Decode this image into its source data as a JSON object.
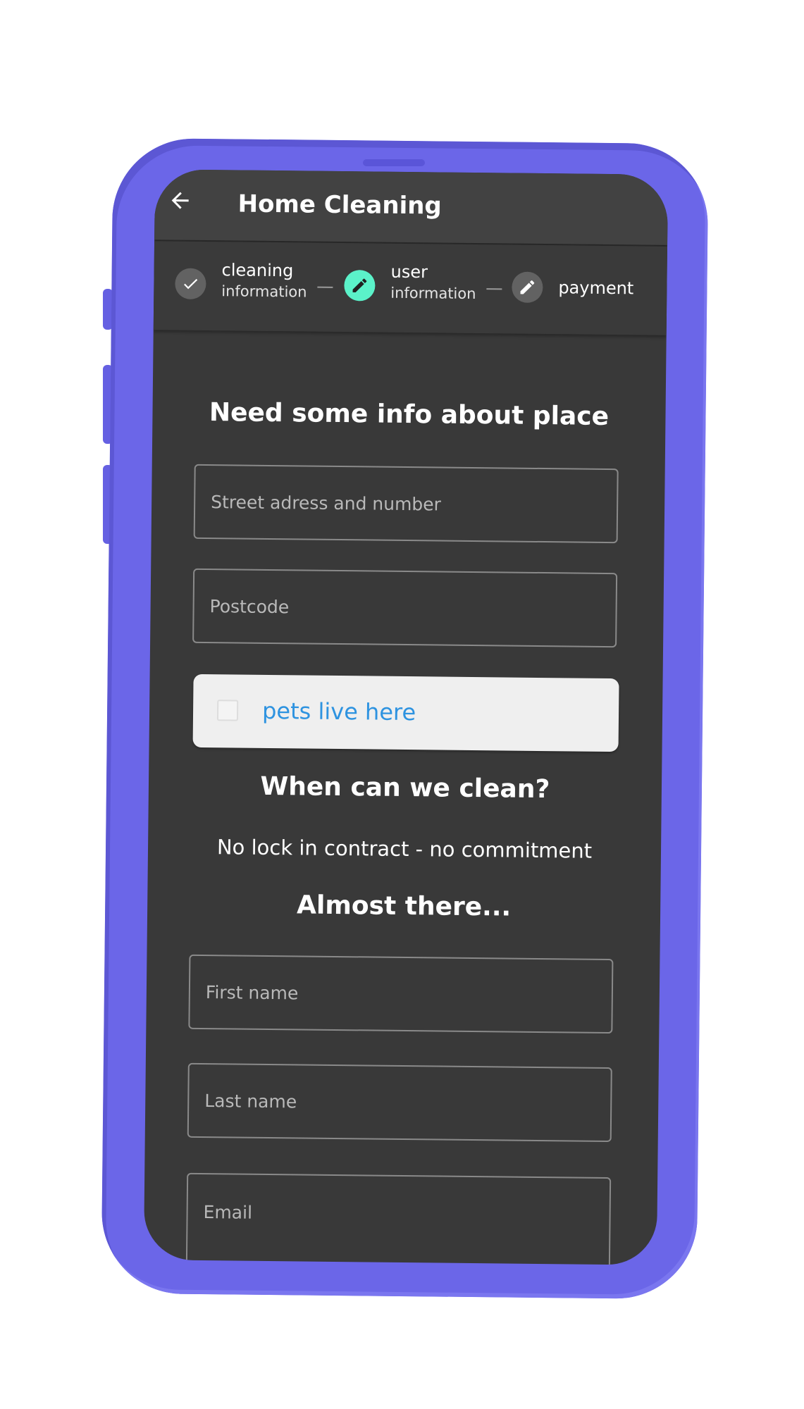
{
  "app_bar": {
    "back_icon": "arrow-left-icon",
    "title": "Home Cleaning"
  },
  "stepper": {
    "steps": [
      {
        "label": "cleaning",
        "sublabel": "information",
        "icon": "check-icon",
        "state": "completed"
      },
      {
        "label": "user",
        "sublabel": "information",
        "icon": "pencil-icon",
        "state": "active"
      },
      {
        "label": "payment",
        "sublabel": "",
        "icon": "pencil-icon",
        "state": "pending"
      }
    ]
  },
  "place_section": {
    "heading": "Need some info about place",
    "street_placeholder": "Street adress and number",
    "postcode_placeholder": "Postcode",
    "pets_label": "pets live here",
    "pets_checked": false
  },
  "schedule_section": {
    "heading": "When can we clean?",
    "note": "No lock in contract - no commitment"
  },
  "contact_section": {
    "heading": "Almost there...",
    "first_name_placeholder": "First name",
    "last_name_placeholder": "Last name",
    "email_placeholder": "Email"
  },
  "colors": {
    "phone_body": "#6b66e8",
    "screen_background": "#393939",
    "app_bar": "#424242",
    "active_step": "#5bf2c9",
    "link_blue": "#2e93e0"
  }
}
